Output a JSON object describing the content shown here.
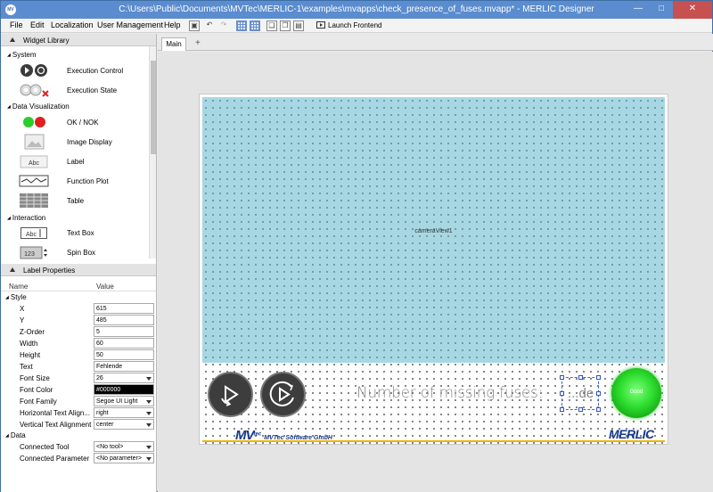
{
  "window": {
    "title": "C:\\Users\\Public\\Documents\\MVTec\\MERLIC-1\\examples\\mvapps\\check_presence_of_fuses.mvapp* - MERLIC Designer",
    "icon": "MV"
  },
  "menu": [
    "File",
    "Edit",
    "Localization",
    "User Management",
    "Help"
  ],
  "toolbar": {
    "launch_label": "Launch Frontend"
  },
  "widget_library": {
    "header": "Widget Library",
    "categories": [
      {
        "label": "System",
        "items": [
          {
            "label": "Execution Control",
            "icon": "execution-control-icon"
          },
          {
            "label": "Execution State",
            "icon": "execution-state-icon"
          }
        ]
      },
      {
        "label": "Data Visualization",
        "items": [
          {
            "label": "OK / NOK",
            "icon": "ok-nok-icon"
          },
          {
            "label": "Image Display",
            "icon": "image-display-icon"
          },
          {
            "label": "Label",
            "icon": "label-icon"
          },
          {
            "label": "Function Plot",
            "icon": "function-plot-icon"
          },
          {
            "label": "Table",
            "icon": "table-icon"
          }
        ]
      },
      {
        "label": "Interaction",
        "items": [
          {
            "label": "Text Box",
            "icon": "text-box-icon"
          },
          {
            "label": "Spin Box",
            "icon": "spin-box-icon"
          }
        ]
      }
    ],
    "label_icon_text": "Abc",
    "textbox_icon_text": "Abc",
    "spinbox_icon_text": "123"
  },
  "label_properties": {
    "header": "Label Properties",
    "col_name": "Name",
    "col_value": "Value",
    "groups": {
      "style": "Style",
      "data": "Data"
    },
    "style_rows": [
      {
        "name": "X",
        "value": "615"
      },
      {
        "name": "Y",
        "value": "485"
      },
      {
        "name": "Z-Order",
        "value": "5"
      },
      {
        "name": "Width",
        "value": "60"
      },
      {
        "name": "Height",
        "value": "50"
      },
      {
        "name": "Text",
        "value": "Fehlende"
      },
      {
        "name": "Font Size",
        "value": "26"
      },
      {
        "name": "Font Color",
        "value": "#000000"
      },
      {
        "name": "Font Family",
        "value": "Segoe UI Light"
      },
      {
        "name": "Horizontal Text Align...",
        "value": "right"
      },
      {
        "name": "Vertical Text Alignment",
        "value": "center"
      }
    ],
    "data_rows": [
      {
        "name": "Connected Tool",
        "value": "<No tool>"
      },
      {
        "name": "Connected Parameter",
        "value": "<No parameter>"
      }
    ]
  },
  "tabs": {
    "main": "Main",
    "add": "+"
  },
  "design": {
    "camera_label": "cameraView1",
    "fuses_text": "Number of missing fuses:",
    "selected_label_text": "...de",
    "good_text": "Good",
    "mvtec_brand": "MVTec Software GmbH",
    "mvtec_mark": "MV",
    "mvtec_sup": "tec",
    "merlic_brand": "MERLIC"
  },
  "colors": {
    "camera_bg": "#a8d7e4",
    "good_led": "#2ddd2d",
    "brand_blue": "#163a8a",
    "accent_line": "#f0b400"
  }
}
